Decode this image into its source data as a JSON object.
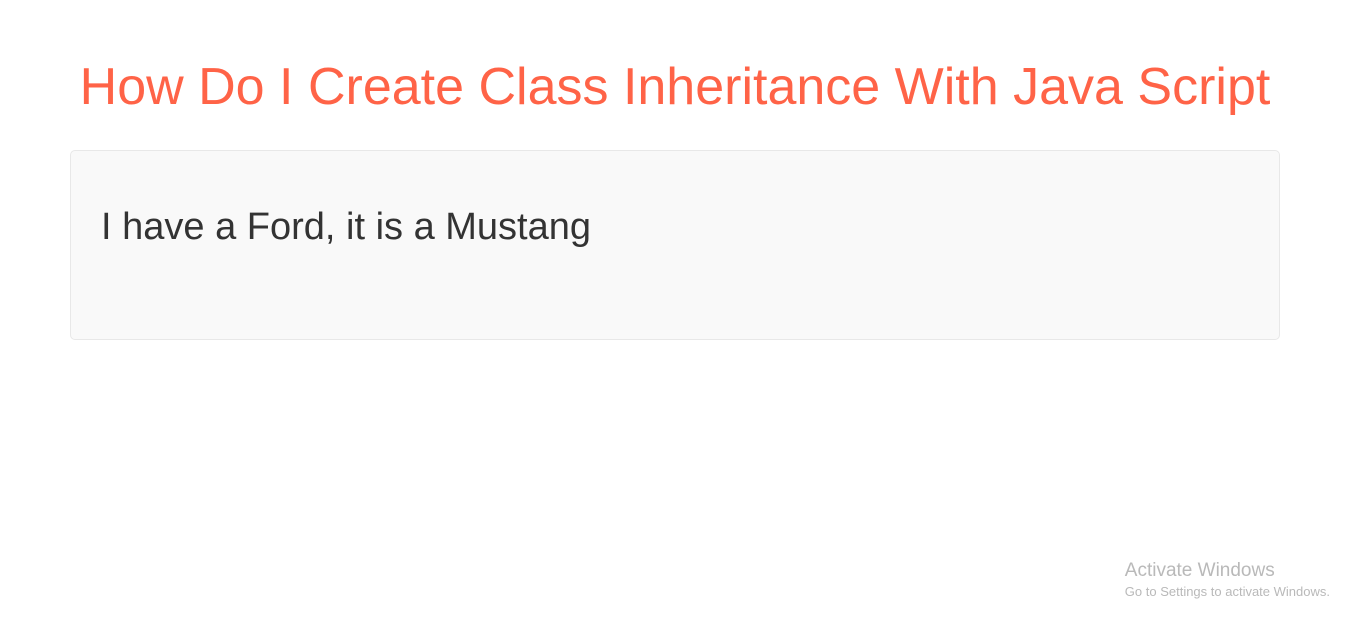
{
  "header": {
    "title": "How Do I Create Class Inheritance With Java Script"
  },
  "output": {
    "text": "I have a Ford, it is a Mustang"
  },
  "watermark": {
    "title": "Activate Windows",
    "subtitle": "Go to Settings to activate Windows."
  }
}
